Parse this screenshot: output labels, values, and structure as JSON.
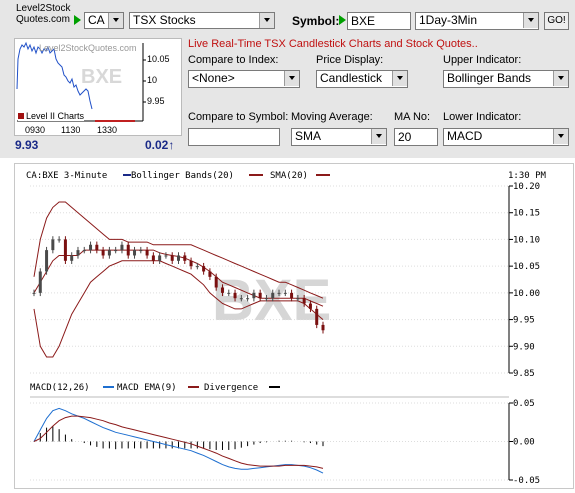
{
  "header": {
    "logo_line1": "Level2Stock",
    "logo_line2": "Quotes.com",
    "country": "CA",
    "exchange": "TSX Stocks",
    "symbol_label": "Symbol:",
    "symbol_value": "BXE",
    "period": "1Day-3Min",
    "go_label": "GO!"
  },
  "mini_chart": {
    "watermark_site": "Level2StockQuotes.com",
    "watermark_symbol": "BXE",
    "level2_label": "Level II Charts",
    "y_ticks": [
      "10.05",
      "10",
      "9.95"
    ],
    "x_ticks": [
      "0930",
      "1130",
      "1330"
    ],
    "last_price": "9.93",
    "change": "0.02",
    "change_icon": "up-arrow-icon"
  },
  "form": {
    "headline": "Live Real-Time TSX Candlestick Charts and Stock Quotes..",
    "compare_index_label": "Compare to Index:",
    "compare_index_value": "<None>",
    "price_display_label": "Price Display:",
    "price_display_value": "Candlestick",
    "upper_indicator_label": "Upper Indicator:",
    "upper_indicator_value": "Bollinger Bands",
    "compare_symbol_label": "Compare to Symbol:",
    "compare_symbol_value": "",
    "moving_average_label": "Moving Average:",
    "moving_average_value": "SMA",
    "ma_no_label": "MA No:",
    "ma_no_value": "20",
    "lower_indicator_label": "Lower Indicator:",
    "lower_indicator_value": "MACD"
  },
  "main_chart": {
    "legend_symbol": "CA:BXE 3-Minute",
    "legend_bb": "Bollinger Bands(20)",
    "legend_sma": "SMA(20)",
    "time_label": "1:30 PM",
    "watermark": "BXE",
    "macd_legend": "MACD(12,26)",
    "macd_ema_legend": "MACD EMA(9)",
    "divergence_legend": "Divergence",
    "colors": {
      "bollinger": "#8b1a1a",
      "macd": "#1e6fd0",
      "ema": "#8b1a1a",
      "candle_down": "#7a1010",
      "candle_up": "#4a4a4a"
    }
  },
  "chart_data": [
    {
      "type": "line",
      "title": "CA:BXE 3-Minute",
      "ylim": [
        9.85,
        10.2
      ],
      "y_ticks": [
        "10.20",
        "10.15",
        "10.10",
        "10.05",
        "10.00",
        "9.95",
        "9.90",
        "9.85"
      ],
      "close": [
        10.0,
        10.04,
        10.08,
        10.1,
        10.1,
        10.06,
        10.07,
        10.08,
        10.08,
        10.09,
        10.08,
        10.07,
        10.08,
        10.08,
        10.09,
        10.07,
        10.08,
        10.08,
        10.07,
        10.06,
        10.07,
        10.07,
        10.06,
        10.07,
        10.06,
        10.05,
        10.05,
        10.04,
        10.03,
        10.01,
        10.0,
        10.0,
        9.99,
        9.99,
        9.99,
        10.0,
        9.99,
        9.99,
        10.0,
        10.0,
        10.0,
        9.99,
        9.99,
        9.98,
        9.97,
        9.94,
        9.93
      ],
      "sma": [
        10.0,
        10.02,
        10.04,
        10.06,
        10.07,
        10.07,
        10.07,
        10.07,
        10.08,
        10.08,
        10.08,
        10.08,
        10.08,
        10.08,
        10.08,
        10.08,
        10.08,
        10.08,
        10.08,
        10.08,
        10.075,
        10.072,
        10.07,
        10.068,
        10.065,
        10.06,
        10.055,
        10.048,
        10.04,
        10.03,
        10.02,
        10.015,
        10.01,
        10.005,
        10.0,
        9.995,
        9.99,
        9.99,
        9.99,
        9.99,
        9.99,
        9.99,
        9.99,
        9.99,
        9.985,
        9.98,
        9.975
      ],
      "bb_upper": [
        10.03,
        10.1,
        10.14,
        10.16,
        10.17,
        10.17,
        10.16,
        10.15,
        10.14,
        10.13,
        10.12,
        10.11,
        10.1,
        10.1,
        10.1,
        10.095,
        10.095,
        10.095,
        10.095,
        10.09,
        10.09,
        10.09,
        10.09,
        10.09,
        10.09,
        10.09,
        10.085,
        10.08,
        10.075,
        10.07,
        10.065,
        10.06,
        10.055,
        10.05,
        10.045,
        10.04,
        10.035,
        10.03,
        10.025,
        10.02,
        10.02,
        10.015,
        10.01,
        10.005,
        10.0,
        9.995,
        9.99
      ],
      "bb_lower": [
        9.97,
        9.9,
        9.88,
        9.88,
        9.9,
        9.93,
        9.96,
        9.98,
        10.0,
        10.02,
        10.03,
        10.04,
        10.05,
        10.055,
        10.06,
        10.06,
        10.06,
        10.06,
        10.06,
        10.06,
        10.06,
        10.055,
        10.05,
        10.045,
        10.04,
        10.035,
        10.025,
        10.015,
        10.0,
        9.99,
        9.98,
        9.975,
        9.97,
        9.97,
        9.975,
        9.98,
        9.985,
        9.985,
        9.985,
        9.985,
        9.985,
        9.985,
        9.985,
        9.98,
        9.97,
        9.96,
        9.95
      ]
    },
    {
      "type": "line",
      "title": "MACD(12,26)",
      "ylim": [
        -0.05,
        0.05
      ],
      "y_ticks": [
        "0.05",
        "0.00",
        "-0.05"
      ],
      "series": [
        {
          "name": "MACD(12,26)",
          "values": [
            0.0,
            0.015,
            0.03,
            0.04,
            0.043,
            0.04,
            0.036,
            0.033,
            0.03,
            0.026,
            0.022,
            0.018,
            0.015,
            0.012,
            0.01,
            0.008,
            0.006,
            0.004,
            0.002,
            0.0,
            -0.002,
            -0.004,
            -0.006,
            -0.008,
            -0.01,
            -0.012,
            -0.015,
            -0.018,
            -0.022,
            -0.026,
            -0.03,
            -0.033,
            -0.035,
            -0.036,
            -0.036,
            -0.035,
            -0.034,
            -0.033,
            -0.032,
            -0.031,
            -0.03,
            -0.03,
            -0.031,
            -0.032,
            -0.034,
            -0.037,
            -0.041
          ]
        },
        {
          "name": "MACD EMA(9)",
          "values": [
            0.0,
            0.004,
            0.012,
            0.02,
            0.027,
            0.031,
            0.033,
            0.033,
            0.032,
            0.031,
            0.029,
            0.027,
            0.024,
            0.022,
            0.019,
            0.017,
            0.015,
            0.013,
            0.011,
            0.009,
            0.007,
            0.005,
            0.003,
            0.001,
            -0.001,
            -0.003,
            -0.006,
            -0.009,
            -0.012,
            -0.015,
            -0.019,
            -0.022,
            -0.025,
            -0.028,
            -0.03,
            -0.031,
            -0.032,
            -0.032,
            -0.032,
            -0.032,
            -0.031,
            -0.031,
            -0.031,
            -0.031,
            -0.032,
            -0.033,
            -0.035
          ]
        },
        {
          "name": "Divergence",
          "values": [
            0.0,
            0.011,
            0.018,
            0.02,
            0.016,
            0.009,
            0.003,
            0.0,
            -0.002,
            -0.005,
            -0.007,
            -0.009,
            -0.009,
            -0.01,
            -0.009,
            -0.009,
            -0.009,
            -0.009,
            -0.009,
            -0.009,
            -0.009,
            -0.009,
            -0.009,
            -0.009,
            -0.009,
            -0.009,
            -0.009,
            -0.009,
            -0.01,
            -0.011,
            -0.011,
            -0.011,
            -0.01,
            -0.008,
            -0.006,
            -0.004,
            -0.002,
            -0.001,
            0.0,
            0.001,
            0.001,
            0.001,
            0.0,
            -0.001,
            -0.002,
            -0.004,
            -0.006
          ]
        }
      ]
    }
  ]
}
